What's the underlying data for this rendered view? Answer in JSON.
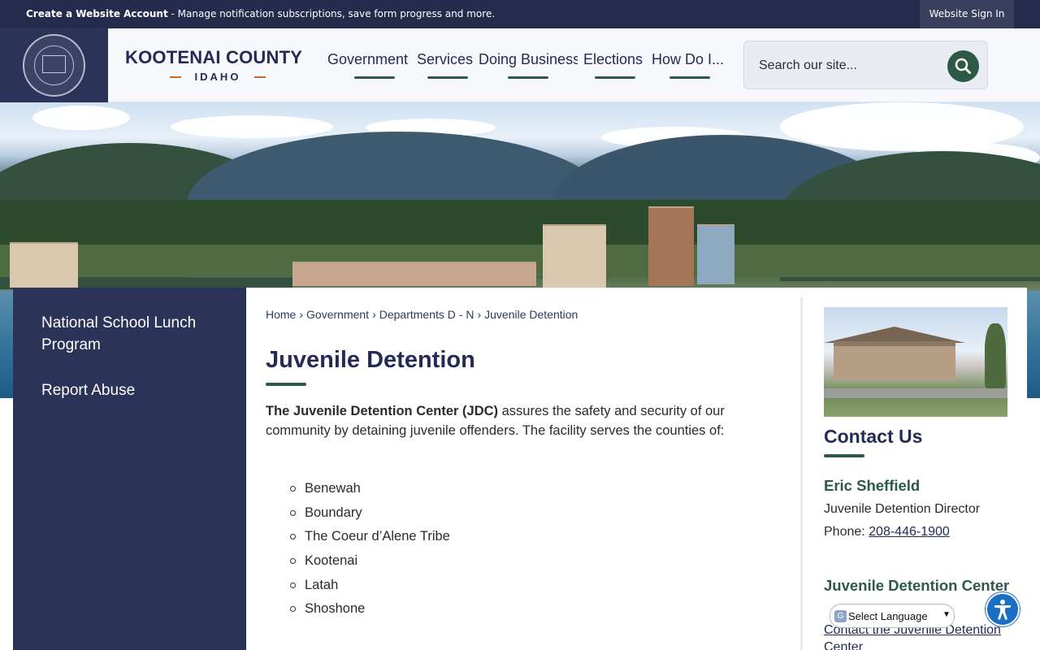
{
  "topbar": {
    "account_bold": "Create a Website Account",
    "account_rest": " - Manage notification subscriptions, save form progress and more.",
    "signin": "Website Sign In"
  },
  "header": {
    "logo_name": "KOOTENAI COUNTY",
    "logo_state": "IDAHO",
    "nav": [
      "Government",
      "Services",
      "Doing Business",
      "Elections",
      "How Do I..."
    ],
    "search_placeholder": "Search our site..."
  },
  "sidebar": {
    "items": [
      {
        "label": "National School Lunch Program"
      },
      {
        "label": "Report Abuse"
      }
    ]
  },
  "breadcrumb": [
    "Home",
    "Government",
    "Departments D - N",
    "Juvenile Detention"
  ],
  "page": {
    "title": "Juvenile Detention",
    "intro_bold": "The Juvenile Detention Center (JDC)",
    "intro_rest": " assures the safety and security of our community by detaining juvenile offenders. The facility serves the counties of:",
    "counties": [
      "Benewah",
      "Boundary",
      "The Coeur d’Alene Tribe",
      "Kootenai",
      "Latah",
      "Shoshone"
    ]
  },
  "contact": {
    "title": "Contact Us",
    "name": "Eric Sheffield",
    "role": "Juvenile Detention Director",
    "phone_label": "Phone: ",
    "phone": "208-446-1900",
    "section_title": "Juvenile Detention Center",
    "section_link": "Contact the Juvenile Detention Center"
  },
  "translate": {
    "label": "Select Language"
  },
  "colors": {
    "navy": "#252b57",
    "green": "#2c5a47",
    "sidebar": "#2c3358",
    "topbar": "#252b4d"
  }
}
